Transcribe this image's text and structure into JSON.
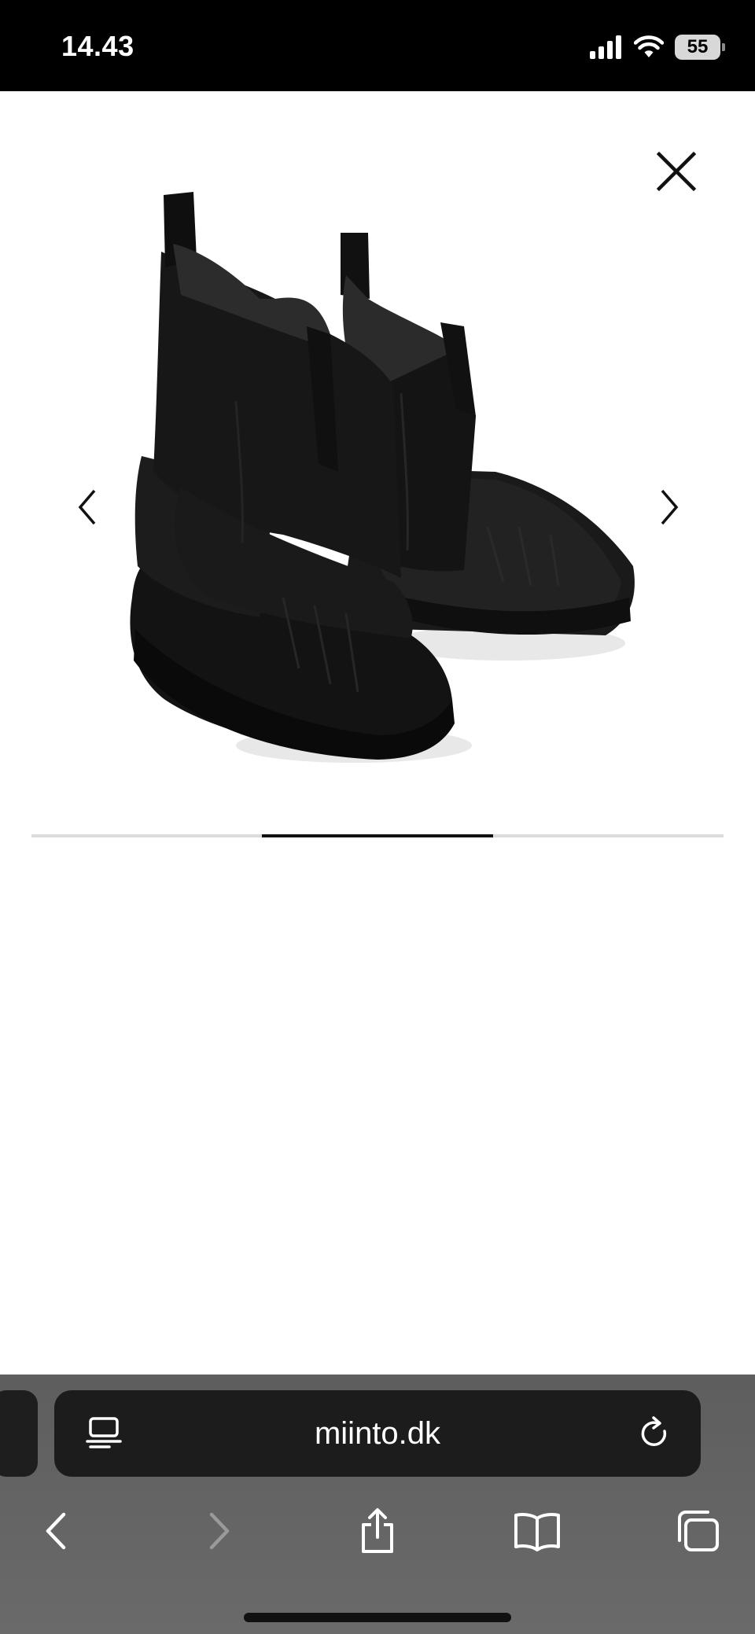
{
  "status_bar": {
    "time": "14.43",
    "battery_level": "55",
    "icons": [
      "cellular-signal-icon",
      "wifi-icon",
      "battery-icon"
    ]
  },
  "gallery": {
    "image": "black-rubber-chelsea-duck-boots",
    "image_index": 2,
    "image_count": 3,
    "controls": [
      "close-icon",
      "chevron-left-icon",
      "chevron-right-icon"
    ]
  },
  "browser": {
    "url": "miinto.dk",
    "address_icons": [
      "reader-mode-icon",
      "reload-icon"
    ],
    "toolbar": [
      "back-icon",
      "forward-icon",
      "share-icon",
      "bookmarks-icon",
      "tabs-icon"
    ],
    "forward_enabled": false
  },
  "colors": {
    "status_bar_bg": "#000000",
    "page_bg": "#ffffff",
    "progress_active": "#111111",
    "progress_track": "#dcdcdc",
    "browser_chrome_bg": "#636363",
    "address_bar_bg": "#1c1c1c"
  }
}
